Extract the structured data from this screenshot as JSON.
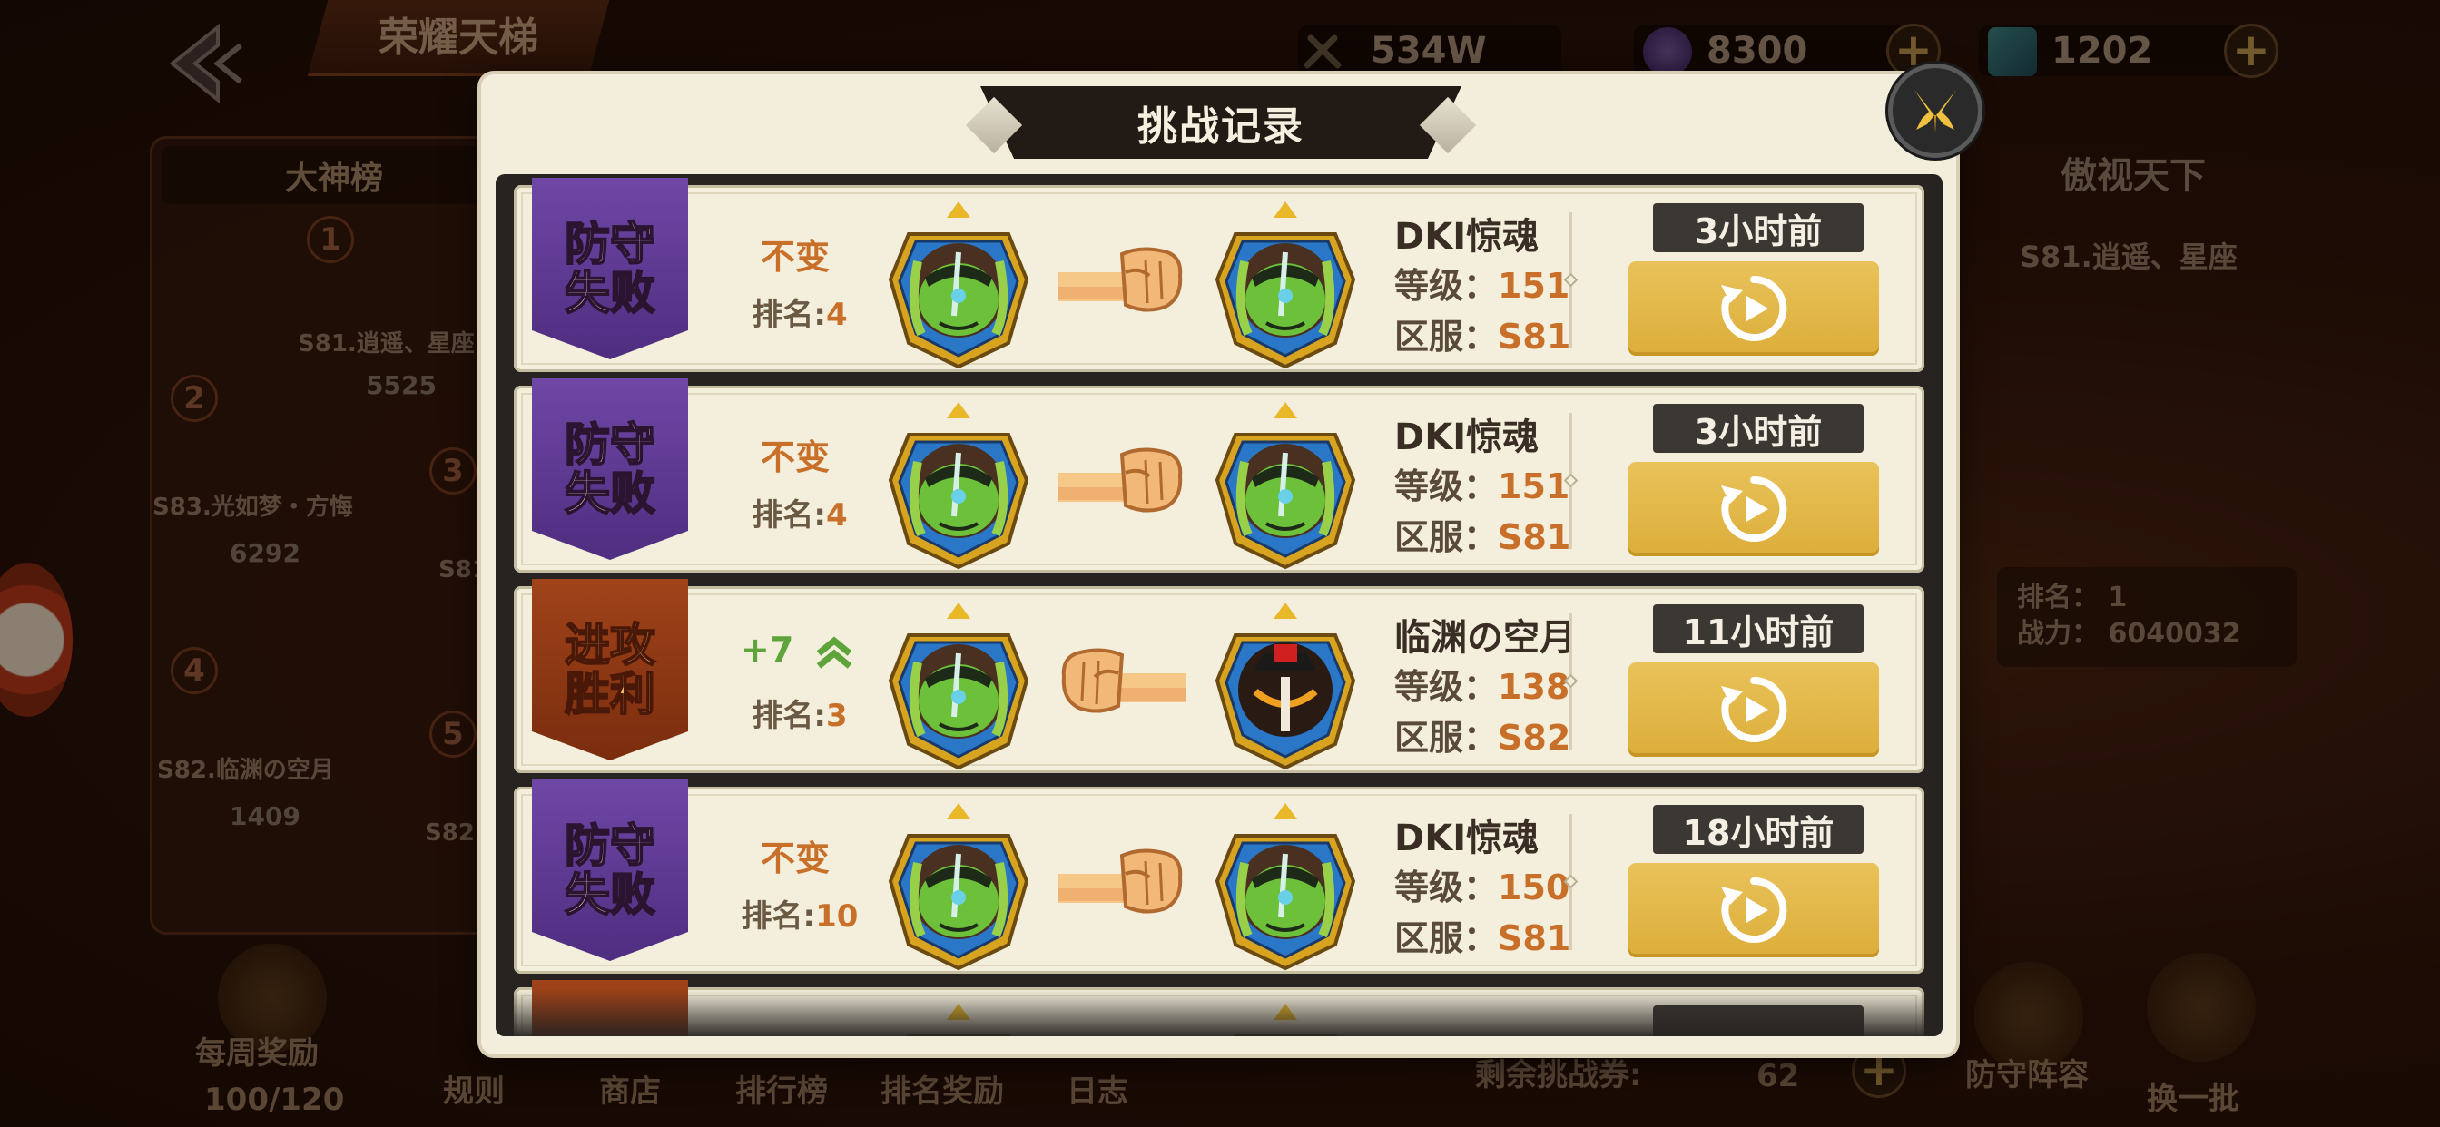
{
  "background": {
    "page_title": "荣耀天梯",
    "combat_power": "534W",
    "currency_1": "8300",
    "currency_2": "1202",
    "leaderboard_tab": "大神榜",
    "leaders": [
      {
        "rank": "1",
        "name": "S81.逍遥、星座",
        "score": "5525"
      },
      {
        "rank": "2",
        "name": "S83.光如梦・方悔",
        "score": "6292"
      },
      {
        "rank": "3",
        "name": "S81",
        "score": ""
      },
      {
        "rank": "4",
        "name": "S82.临渊の空月",
        "score": "1409"
      },
      {
        "rank": "5",
        "name": "S82.",
        "score": ""
      }
    ],
    "champion_banner": "傲视天下",
    "champion_name": "S81.逍遥、星座",
    "champion_rank": "排名：  1",
    "champion_power": "战力：  6040032",
    "bottom_items": {
      "weekly_reward": "每周奖励",
      "weekly_progress": "100/120",
      "rules": "规则",
      "shop": "商店",
      "leaderboard": "排行榜",
      "rank_reward": "排名奖励",
      "log": "日志",
      "remaining_tickets_label": "剩余挑战券:",
      "remaining_tickets": "62",
      "defense_lineup": "防守阵容",
      "refresh": "换一批"
    }
  },
  "modal": {
    "title": "挑战记录",
    "records": [
      {
        "result": "防守失败",
        "result_type": "lose",
        "rank_change": "不变",
        "rank_label": "排名:",
        "rank": "4",
        "opponent_name": "DKI惊魂",
        "level_label": "等级：",
        "level": "151",
        "server_label": "区服：",
        "server": "S81",
        "time": "3小时前"
      },
      {
        "result": "防守失败",
        "result_type": "lose",
        "rank_change": "不变",
        "rank_label": "排名:",
        "rank": "4",
        "opponent_name": "DKI惊魂",
        "level_label": "等级：",
        "level": "151",
        "server_label": "区服：",
        "server": "S81",
        "time": "3小时前"
      },
      {
        "result": "进攻胜利",
        "result_type": "win",
        "rank_change": "+7",
        "rank_label": "排名:",
        "rank": "3",
        "opponent_name": "临渊の空月",
        "level_label": "等级：",
        "level": "138",
        "server_label": "区服：",
        "server": "S82",
        "time": "11小时前"
      },
      {
        "result": "防守失败",
        "result_type": "lose",
        "rank_change": "不变",
        "rank_label": "排名:",
        "rank": "10",
        "opponent_name": "DKI惊魂",
        "level_label": "等级：",
        "level": "150",
        "server_label": "区服：",
        "server": "S81",
        "time": "18小时前"
      }
    ]
  },
  "colors": {
    "lose_badge": "#5f3a95",
    "win_badge": "#8f3a16",
    "accent_orange": "#c8702a",
    "rank_up_green": "#5ea43a",
    "replay_gold": "#e3b84b",
    "modal_bg": "#f3eedc"
  },
  "icons": {
    "back": "back-arrow-icon",
    "close": "close-x-icon",
    "replay": "replay-icon",
    "fist": "fist-icon",
    "rank_up": "double-chevron-up-icon",
    "avatar": "hero-avatar-icon"
  }
}
